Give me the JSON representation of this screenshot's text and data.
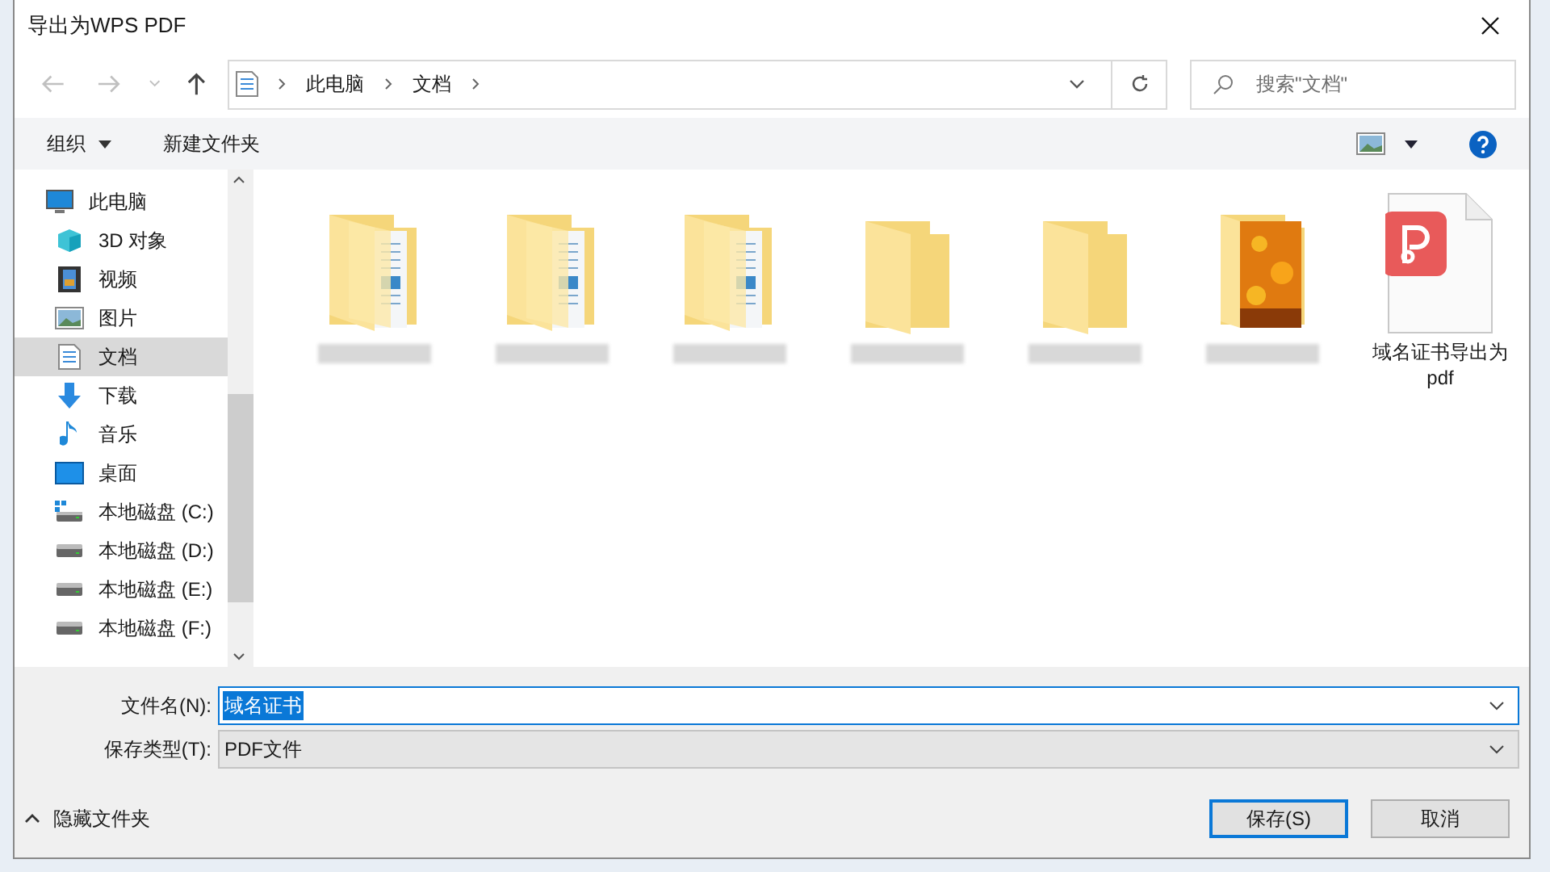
{
  "window": {
    "title": "导出为WPS PDF"
  },
  "breadcrumb": [
    "此电脑",
    "文档"
  ],
  "search": {
    "placeholder": "搜索\"文档\""
  },
  "toolbar": {
    "organize": "组织",
    "new_folder": "新建文件夹"
  },
  "sidebar": {
    "items": [
      {
        "label": "此电脑",
        "kind": "computer",
        "selected": false,
        "children": [
          {
            "label": "3D 对象",
            "kind": "cube",
            "selected": false
          },
          {
            "label": "视频",
            "kind": "film",
            "selected": false
          },
          {
            "label": "图片",
            "kind": "picture",
            "selected": false
          },
          {
            "label": "文档",
            "kind": "document",
            "selected": true
          },
          {
            "label": "下载",
            "kind": "download",
            "selected": false
          },
          {
            "label": "音乐",
            "kind": "music",
            "selected": false
          },
          {
            "label": "桌面",
            "kind": "desktop",
            "selected": false
          },
          {
            "label": "本地磁盘 (C:)",
            "kind": "system-drive",
            "selected": false
          },
          {
            "label": "本地磁盘 (D:)",
            "kind": "drive",
            "selected": false
          },
          {
            "label": "本地磁盘 (E:)",
            "kind": "drive",
            "selected": false
          },
          {
            "label": "本地磁盘 (F:)",
            "kind": "drive",
            "selected": false
          }
        ]
      }
    ]
  },
  "files": [
    {
      "kind": "folder-docs"
    },
    {
      "kind": "folder-docs"
    },
    {
      "kind": "folder-docs"
    },
    {
      "kind": "folder"
    },
    {
      "kind": "folder"
    },
    {
      "kind": "folder-photo"
    },
    {
      "kind": "pdf",
      "label": "域名证书导出为pdf"
    }
  ],
  "form": {
    "filename_label": "文件名(N):",
    "filename": "域名证书",
    "type_label": "保存类型(T):",
    "type": "PDF文件"
  },
  "hide_folders": "隐藏文件夹",
  "buttons": {
    "save": "保存(S)",
    "cancel": "取消"
  }
}
